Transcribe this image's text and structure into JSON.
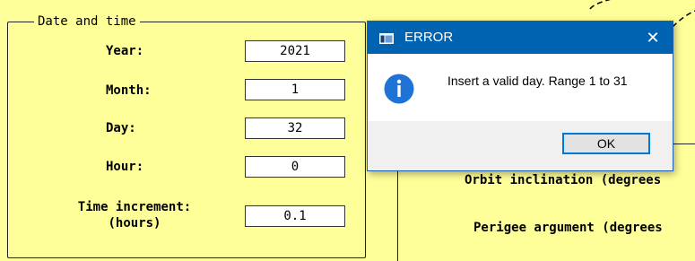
{
  "form": {
    "group_title": "Date and time",
    "fields": [
      {
        "label": "Year:",
        "value": "2021"
      },
      {
        "label": "Month:",
        "value": "1"
      },
      {
        "label": "Day:",
        "value": "32"
      },
      {
        "label": "Hour:",
        "value": "0"
      },
      {
        "label": "Time increment:\n(hours)",
        "value": "0.1"
      }
    ]
  },
  "orbit": {
    "labels": [
      "Orbit inclination (degrees",
      "Perigee argument (degrees"
    ]
  },
  "dialog": {
    "title": "ERROR",
    "message": "Insert a valid day. Range 1 to 31",
    "ok_label": "OK",
    "close_glyph": "✕",
    "icon": "info-icon",
    "titlebar_color": "#0063b1"
  }
}
